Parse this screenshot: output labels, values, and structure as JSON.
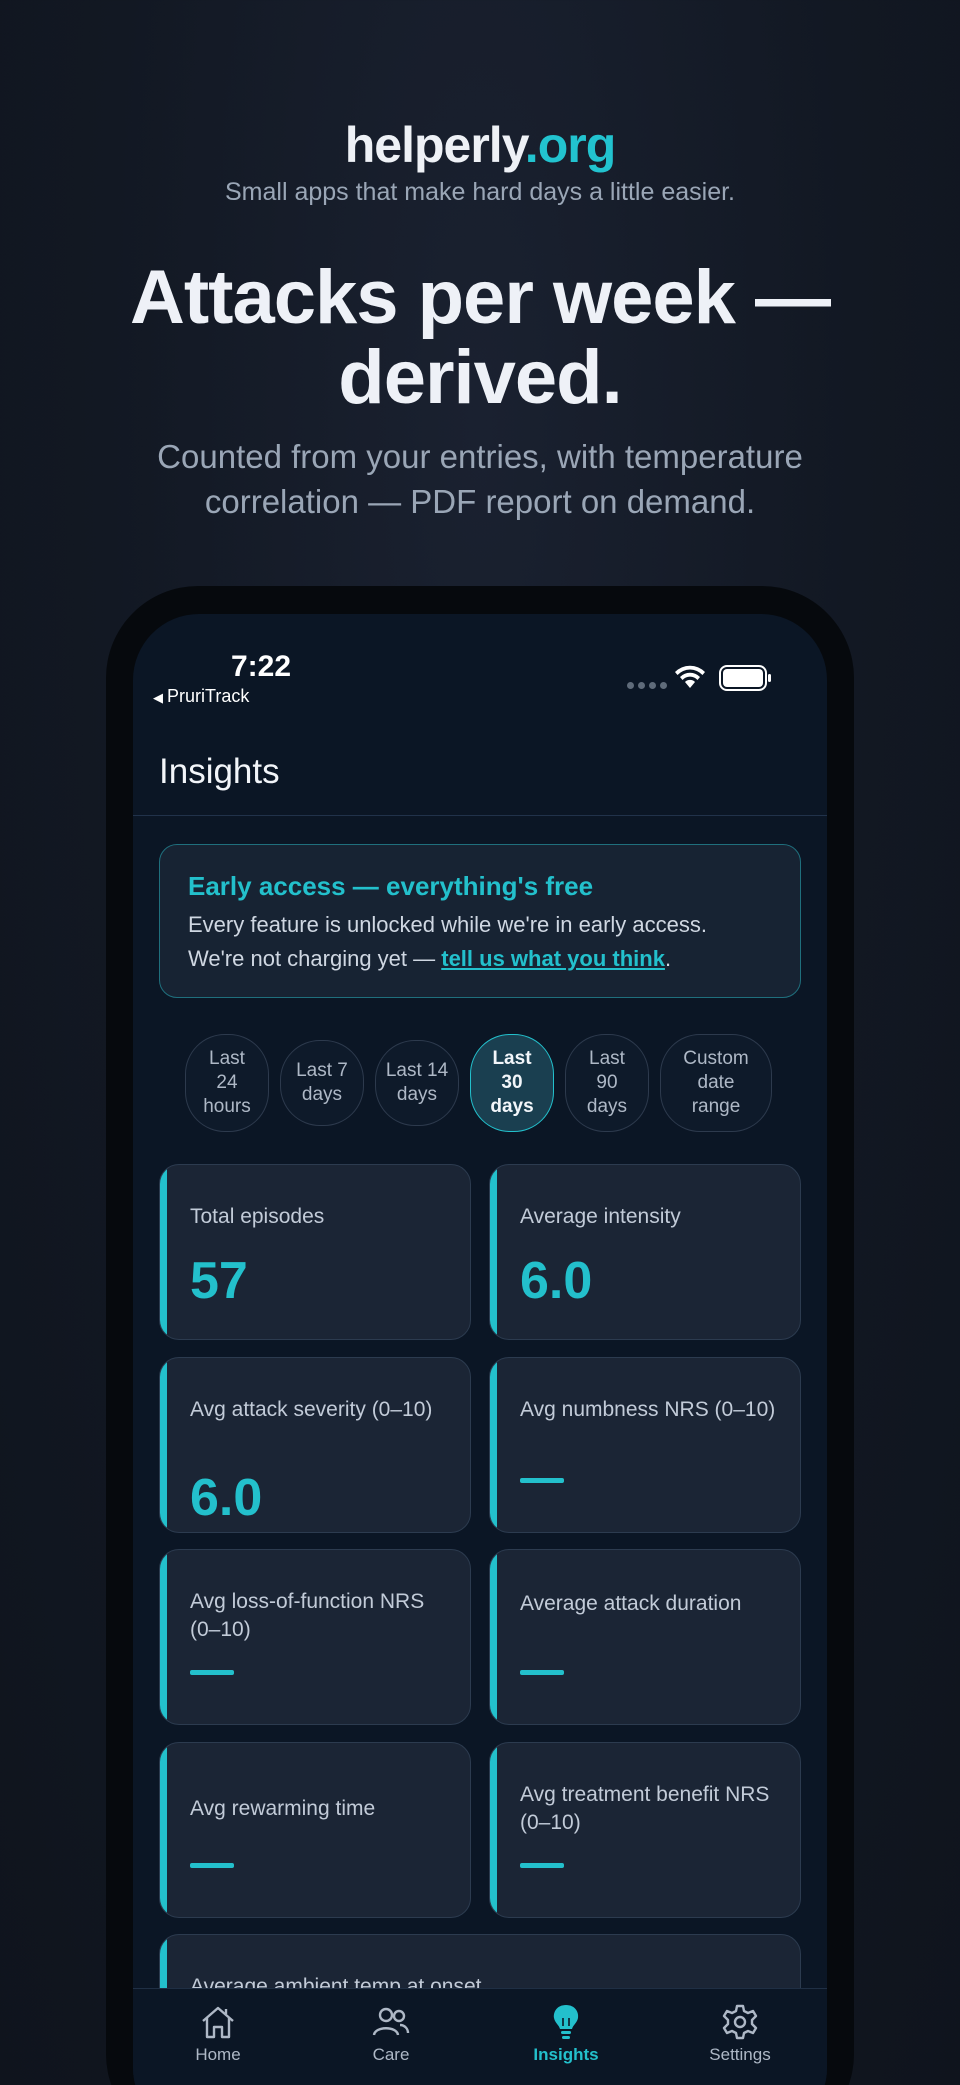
{
  "brand": {
    "name": "helperly",
    "tld": ".org",
    "tagline": "Small apps that make hard days a little easier."
  },
  "hero": {
    "headline_line1": "Attacks per week —",
    "headline_line2": "derived.",
    "subhead_line1": "Counted from your entries, with temperature",
    "subhead_line2": "correlation — PDF report on demand."
  },
  "status_bar": {
    "time": "7:22",
    "back_app": "PruriTrack"
  },
  "screen": {
    "title": "Insights",
    "banner": {
      "title": "Early access — everything's free",
      "line1": "Every feature is unlocked while we're in early access.",
      "line2_prefix": "We're not charging yet — ",
      "link": "tell us what you think",
      "line2_suffix": "."
    },
    "ranges": [
      {
        "l1": "Last",
        "l2": "24",
        "l3": "hours",
        "active": false
      },
      {
        "l1": "Last 7",
        "l2": "days",
        "active": false
      },
      {
        "l1": "Last 14",
        "l2": "days",
        "active": false
      },
      {
        "l1": "Last",
        "l2": "30",
        "l3": "days",
        "active": true
      },
      {
        "l1": "Last",
        "l2": "90",
        "l3": "days",
        "active": false
      },
      {
        "l1": "Custom",
        "l2": "date",
        "l3": "range",
        "active": false
      }
    ],
    "stats": [
      {
        "label": "Total episodes",
        "value": "57"
      },
      {
        "label": "Average intensity",
        "value": "6.0"
      },
      {
        "label": "Avg attack severity (0–10)",
        "value": "6.0"
      },
      {
        "label": "Avg numbness NRS (0–10)",
        "value": "—"
      },
      {
        "label": "Avg loss-of-function NRS (0–10)",
        "value": "—"
      },
      {
        "label": "Average attack duration",
        "value": "—"
      },
      {
        "label": "Avg rewarming time",
        "value": "—"
      },
      {
        "label": "Avg treatment benefit NRS (0–10)",
        "value": "—"
      },
      {
        "label": "Average ambient temp at onset",
        "value": ""
      }
    ]
  },
  "tabs": [
    {
      "label": "Home",
      "icon": "home-icon"
    },
    {
      "label": "Care",
      "icon": "people-icon"
    },
    {
      "label": "Insights",
      "icon": "lightbulb-icon",
      "active": true
    },
    {
      "label": "Settings",
      "icon": "gear-icon"
    }
  ],
  "colors": {
    "accent": "#23c0cc",
    "background": "#121823",
    "card": "#1b2535"
  }
}
